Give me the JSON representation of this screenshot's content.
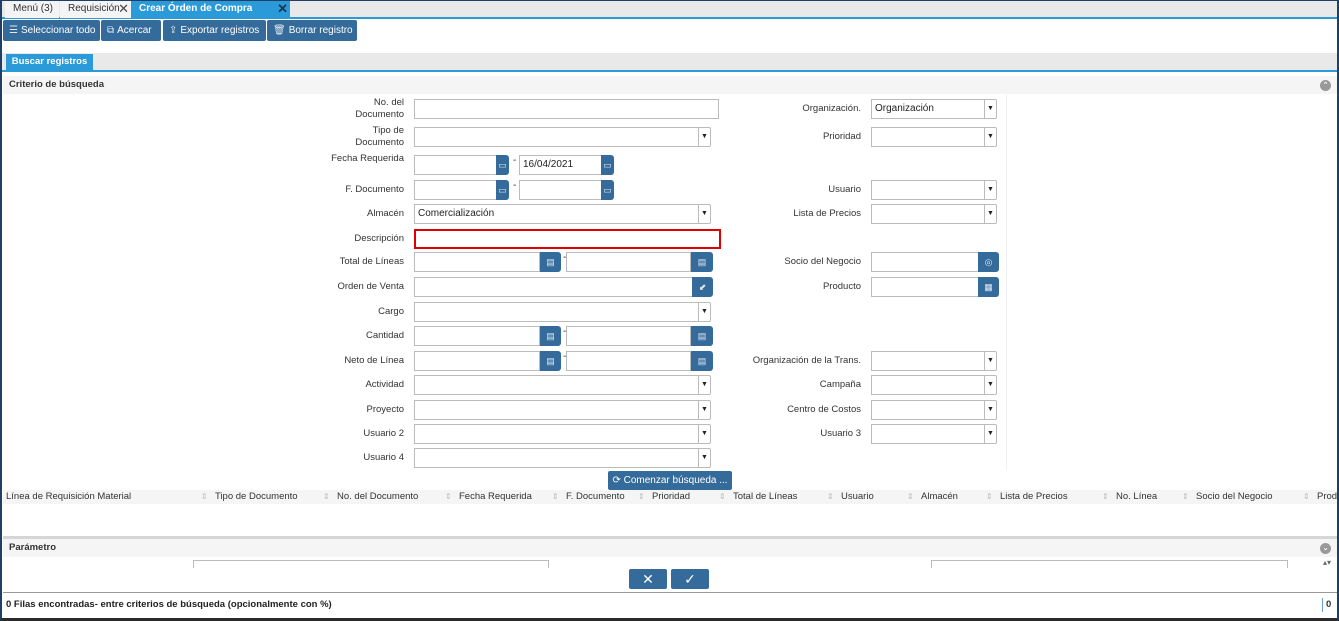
{
  "tabs": [
    {
      "label": "Menú (3)"
    },
    {
      "label": "Requisición",
      "closable": true
    },
    {
      "label": "Crear Órden de Compra desde...",
      "closable": true,
      "active": true
    }
  ],
  "toolbar": {
    "select_all": "Seleccionar todo",
    "zoom": "Acercar",
    "export": "Exportar registros",
    "delete": "Borrar registro"
  },
  "search_tab": "Buscar registros",
  "criteria_title": "Criterio de búsqueda",
  "form_left": [
    {
      "label": "No. del Documento",
      "value": "",
      "type": "text"
    },
    {
      "label": "Tipo de Documento",
      "value": "",
      "type": "select"
    },
    {
      "label": "Fecha Requerida",
      "from": "",
      "to": "16/04/2021",
      "type": "date-range"
    },
    {
      "label": "F. Documento",
      "from": "",
      "to": "",
      "type": "date-range"
    },
    {
      "label": "Almacén",
      "value": "Comercialización",
      "type": "select"
    },
    {
      "label": "Descripción",
      "value": "",
      "type": "text",
      "highlighted": true
    },
    {
      "label": "Total de Líneas",
      "from": "",
      "to": "",
      "type": "number-range"
    },
    {
      "label": "Orden de Venta",
      "value": "",
      "type": "search"
    },
    {
      "label": "Cargo",
      "value": "",
      "type": "select"
    },
    {
      "label": "Cantidad",
      "from": "",
      "to": "",
      "type": "number-range"
    },
    {
      "label": "Neto de Línea",
      "from": "",
      "to": "",
      "type": "number-range"
    },
    {
      "label": "Actividad",
      "value": "",
      "type": "select"
    },
    {
      "label": "Proyecto",
      "value": "",
      "type": "select"
    },
    {
      "label": "Usuario 2",
      "value": "",
      "type": "select"
    },
    {
      "label": "Usuario 4",
      "value": "",
      "type": "select"
    }
  ],
  "form_right": [
    {
      "label": "Organización.",
      "value": "Organización",
      "type": "select"
    },
    {
      "label": "Prioridad",
      "value": "",
      "type": "select"
    },
    {
      "label": "Usuario",
      "value": "",
      "type": "select"
    },
    {
      "label": "Lista de Precios",
      "value": "",
      "type": "select"
    },
    {
      "label": "Socio del Negocio",
      "value": "",
      "type": "search"
    },
    {
      "label": "Producto",
      "value": "",
      "type": "search"
    },
    {
      "label": "Organización de la Trans.",
      "value": "",
      "type": "select"
    },
    {
      "label": "Campaña",
      "value": "",
      "type": "select"
    },
    {
      "label": "Centro de Costos",
      "value": "",
      "type": "select"
    },
    {
      "label": "Usuario 3",
      "value": "",
      "type": "select"
    }
  ],
  "start_search": "Comenzar búsqueda ...",
  "columns": [
    "Línea de Requisición Material",
    "Tipo de Documento",
    "No. del Documento",
    "Fecha Requerida",
    "F. Documento",
    "Prioridad",
    "Total de Líneas",
    "Usuario",
    "Almacén",
    "Lista de Precios",
    "No. Línea",
    "Socio del Negocio",
    "Prod"
  ],
  "parameter_title": "Parámetro",
  "status": {
    "text": "0 Filas encontradas- entre criterios de búsqueda (opcionalmente con %)",
    "count": "0"
  },
  "colors": {
    "accent": "#2a9ad9",
    "button": "#346b9b",
    "highlight": "#e00000"
  }
}
